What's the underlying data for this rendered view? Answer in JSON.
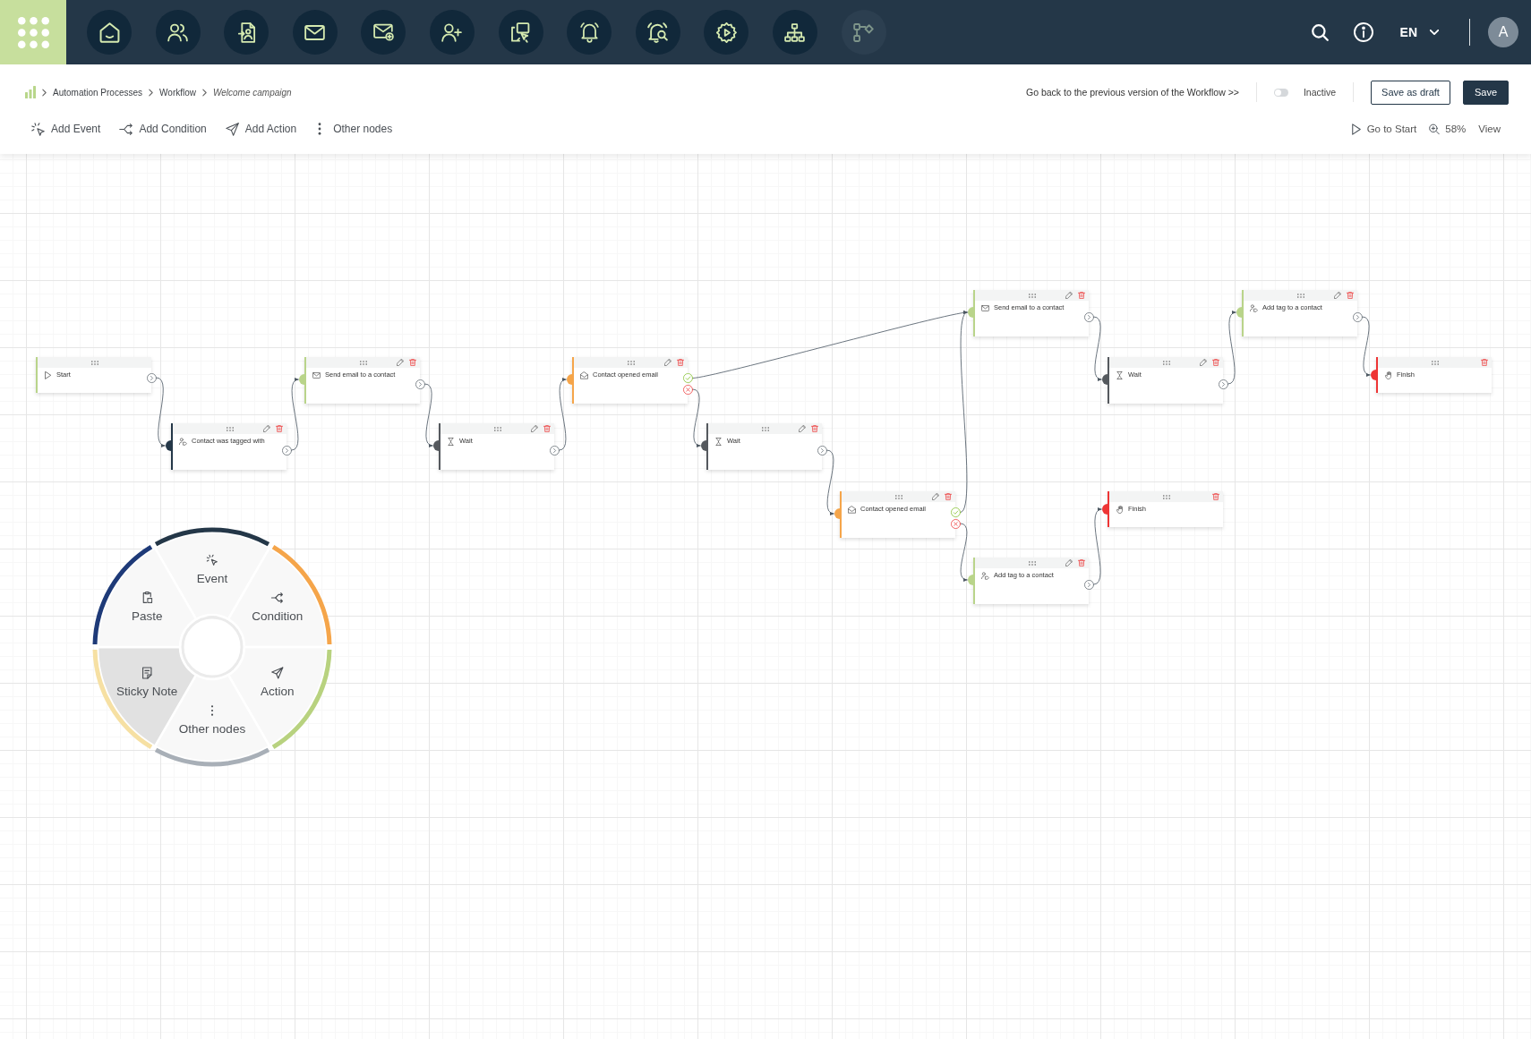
{
  "top_nav": {
    "items": [
      {
        "disabled": false
      },
      {
        "disabled": false
      },
      {
        "disabled": false
      },
      {
        "disabled": false
      },
      {
        "disabled": false
      },
      {
        "disabled": false
      },
      {
        "disabled": false
      },
      {
        "disabled": false
      },
      {
        "disabled": false
      },
      {
        "disabled": false
      },
      {
        "disabled": false
      },
      {
        "disabled": true
      }
    ],
    "language": "EN",
    "avatar": "A"
  },
  "breadcrumb": [
    "Automation Processes",
    "Workflow",
    "Welcome campaign"
  ],
  "header": {
    "previous_version_link": "Go back to the previous version of the Workflow >>",
    "status_toggle": {
      "label": "Inactive",
      "on": false
    },
    "buttons": [
      {
        "label": "Save as draft",
        "kind": "secondary"
      },
      {
        "label": "Save",
        "kind": "primary"
      }
    ]
  },
  "toolbar": {
    "items": [
      {
        "label": "Add Event",
        "kind": "event"
      },
      {
        "label": "Add Condition",
        "kind": "condition"
      },
      {
        "label": "Add Action",
        "kind": "action"
      },
      {
        "label": "Other nodes",
        "kind": "more"
      }
    ],
    "view_controls": [
      {
        "label": "Go to Start",
        "kind": "start"
      },
      {
        "label": "58%",
        "kind": "zoom"
      },
      {
        "label": "View",
        "kind": "view"
      }
    ]
  },
  "canvas": {
    "nodes": [
      {
        "kind": "start",
        "title": "Start"
      },
      {
        "kind": "tagged",
        "title": "Contact was tagged with"
      },
      {
        "kind": "email",
        "title": "Send email to a contact"
      },
      {
        "kind": "wait",
        "title": "Wait"
      },
      {
        "kind": "opened",
        "title": "Contact opened email"
      },
      {
        "kind": "wait",
        "title": "Wait"
      },
      {
        "kind": "opened",
        "title": "Contact opened email"
      },
      {
        "kind": "email",
        "title": "Send email to a contact"
      },
      {
        "kind": "tag",
        "title": "Add tag to a contact"
      },
      {
        "kind": "wait",
        "title": "Wait"
      },
      {
        "kind": "finish",
        "title": "Finish"
      },
      {
        "kind": "tag",
        "title": "Add tag to a contact"
      },
      {
        "kind": "finish",
        "title": "Finish"
      }
    ]
  },
  "radial_menu": {
    "items": [
      {
        "label": "Event",
        "kind": "event",
        "color": "#243748",
        "selected": false
      },
      {
        "label": "Condition",
        "kind": "condition",
        "color": "#f5a54a",
        "selected": false
      },
      {
        "label": "Action",
        "kind": "action",
        "color": "#b8d27f",
        "selected": false
      },
      {
        "label": "Other nodes",
        "kind": "more",
        "color": "#a8afb7",
        "selected": false
      },
      {
        "label": "Sticky Note",
        "kind": "note",
        "color": "#f6e0a3",
        "selected": true
      },
      {
        "label": "Paste",
        "kind": "paste",
        "color": "#1e3a78",
        "selected": false
      }
    ]
  }
}
